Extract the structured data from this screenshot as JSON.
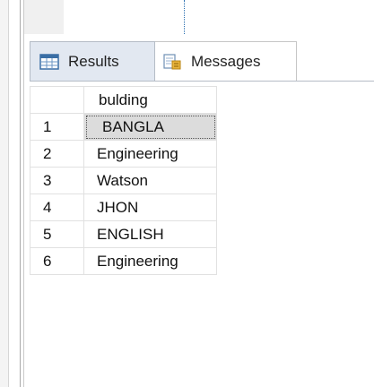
{
  "tabs": [
    {
      "label": "Results",
      "icon": "grid-icon",
      "active": true
    },
    {
      "label": "Messages",
      "icon": "messages-icon",
      "active": false
    }
  ],
  "grid": {
    "columns": [
      "bulding"
    ],
    "rows": [
      {
        "num": "1",
        "bulding": "BANGLA"
      },
      {
        "num": "2",
        "bulding": "Engineering"
      },
      {
        "num": "3",
        "bulding": "Watson"
      },
      {
        "num": "4",
        "bulding": "JHON"
      },
      {
        "num": "5",
        "bulding": "ENGLISH"
      },
      {
        "num": "6",
        "bulding": "Engineering"
      }
    ],
    "selected_row": 0
  }
}
